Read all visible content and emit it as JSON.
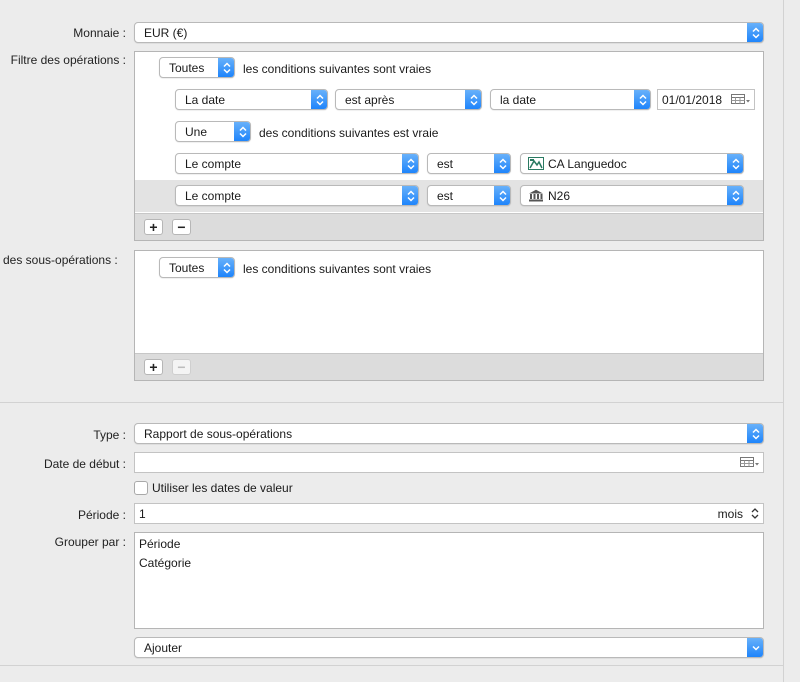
{
  "labels": {
    "monnaie": "Monnaie :",
    "filtre_operations": "Filtre des opérations :",
    "sous_operations": "des sous-opérations :",
    "type": "Type :",
    "date_debut": "Date de début :",
    "periode": "Période :",
    "grouper_par": "Grouper par :"
  },
  "monnaie": {
    "value": "EUR (€)"
  },
  "filter_ops": {
    "match_mode": "Toutes",
    "match_text": "les conditions suivantes sont vraies",
    "date_rule": {
      "field": "La date",
      "operator": "est après",
      "reference": "la date",
      "date_value": "01/01/2018"
    },
    "sub_group": {
      "match_mode": "Une",
      "match_text": "des conditions suivantes est vraie",
      "rules": [
        {
          "field": "Le compte",
          "operator": "est",
          "account": "CA Languedoc",
          "icon": "ca-bank-logo-icon"
        },
        {
          "field": "Le compte",
          "operator": "est",
          "account": "N26",
          "icon": "bank-building-icon"
        }
      ]
    },
    "add_label": "+",
    "remove_label": "−"
  },
  "filter_subops": {
    "match_mode": "Toutes",
    "match_text": "les conditions suivantes sont vraies",
    "add_label": "+",
    "remove_label": "−"
  },
  "report": {
    "type_value": "Rapport de sous-opérations",
    "date_debut_value": "",
    "use_value_dates_label": "Utiliser les dates de valeur",
    "use_value_dates_checked": false,
    "periode_value": "1",
    "periode_unit": "mois",
    "group_by": [
      "Période",
      "Catégorie"
    ],
    "add_popup": "Ajouter"
  },
  "colors": {
    "accent": "#1a82fb",
    "selected_row": "#e3e3e3",
    "window_bg": "#ececec"
  }
}
